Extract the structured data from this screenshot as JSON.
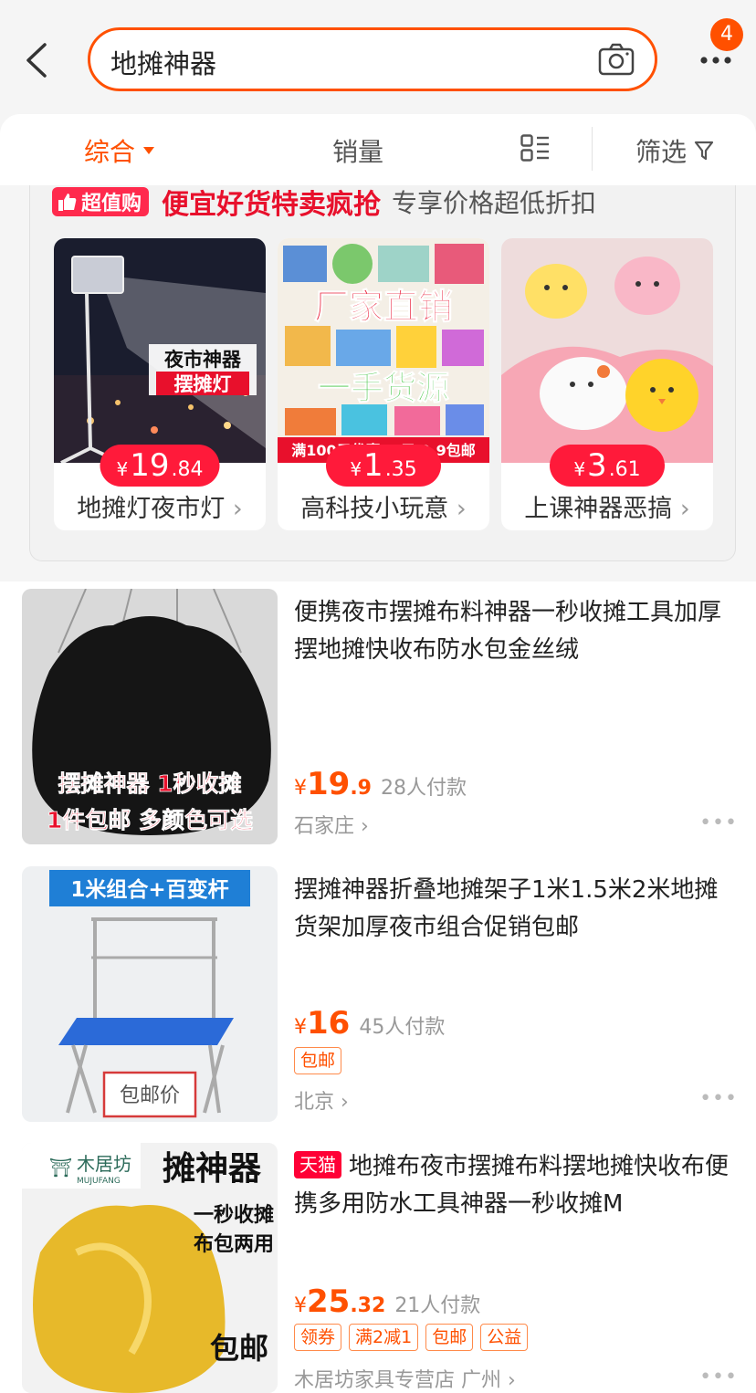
{
  "header": {
    "search_value": "地摊神器",
    "badge_count": "4"
  },
  "tabs": {
    "comprehensive": "综合",
    "sales": "销量",
    "filter": "筛选"
  },
  "promo": {
    "badge": "超值购",
    "title": "便宜好货特卖疯抢",
    "subtitle": "专享价格超低折扣",
    "cards": [
      {
        "price_symbol": "¥",
        "price_int": "19",
        "price_dec": ".84",
        "label": "地摊灯夜市灯",
        "image_text": [
          "夜市神器",
          "摆摊灯"
        ]
      },
      {
        "price_symbol": "¥",
        "price_int": "1",
        "price_dec": ".35",
        "label": "高科技小玩意",
        "image_text": [
          "厂家直销",
          "一手货源",
          "满100元优惠10元 9.9包邮"
        ]
      },
      {
        "price_symbol": "¥",
        "price_int": "3",
        "price_dec": ".61",
        "label": "上课神器恶搞",
        "image_text": []
      }
    ]
  },
  "items": [
    {
      "title": "便携夜市摆摊布料神器一秒收摊工具加厚摆地摊快收布防水包金丝绒",
      "price_symbol": "¥",
      "price_int": "19",
      "price_dec": ".9",
      "sales": "28人付款",
      "tags": [],
      "location": "石家庄",
      "image_text": [
        "摆摊神器 1秒收摊",
        "1件包邮 多颜色可选"
      ]
    },
    {
      "title": "摆摊神器折叠地摊架子1米1.5米2米地摊货架加厚夜市组合促销包邮",
      "price_symbol": "¥",
      "price_int": "16",
      "price_dec": "",
      "sales": "45人付款",
      "tags": [
        "包邮"
      ],
      "location": "北京",
      "image_text": [
        "1米组合+百变杆",
        "包邮价"
      ]
    },
    {
      "tmall": "天猫",
      "title": "地摊布夜市摆摊布料摆地摊快收布便携多用防水工具神器一秒收摊M",
      "price_symbol": "¥",
      "price_int": "25",
      "price_dec": ".32",
      "sales": "21人付款",
      "tags": [
        "领券",
        "满2减1",
        "包邮",
        "公益"
      ],
      "location": "木居坊家具专营店 广州",
      "image_text": [
        "木居坊",
        "MUJUFANG",
        "摊神器",
        "一秒收摊",
        "布包两用",
        "包邮"
      ]
    }
  ],
  "colors": {
    "accent": "#ff5000",
    "promo_red": "#ff1a3a"
  }
}
